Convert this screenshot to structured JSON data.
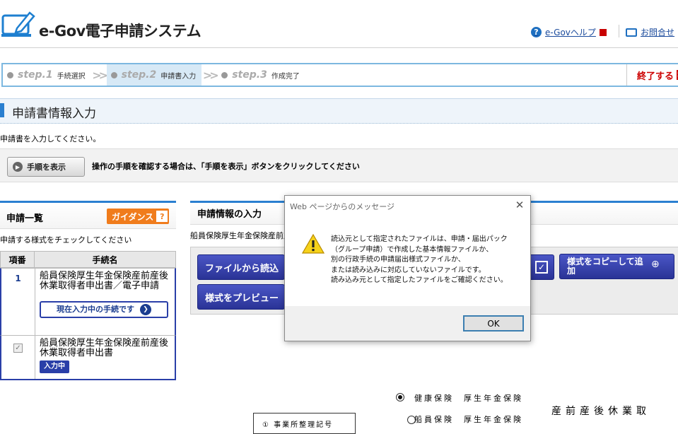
{
  "header": {
    "logo_text": "e-Gov電子申請システム",
    "help_link": "e-Govヘルプ",
    "contact_link": "お問合せ"
  },
  "steps": [
    {
      "num": "step.1",
      "label": "手続選択"
    },
    {
      "num": "step.2",
      "label": "申請書入力"
    },
    {
      "num": "step.3",
      "label": "作成完了"
    }
  ],
  "finish_label": "終了する",
  "page_title": "申請書情報入力",
  "instruction": "申請書を入力してください。",
  "procedure": {
    "button_label": "手順を表示",
    "text": "操作の手順を確認する場合は、「手順を表示」ボタンをクリックしてください"
  },
  "left_panel": {
    "title": "申請一覧",
    "guidance_label": "ガイダンス",
    "instruction": "申請する様式をチェックしてください",
    "col_no": "項番",
    "col_name": "手続名",
    "rows": [
      {
        "no": "1",
        "name": "船員保険厚生年金保険産前産後休業取得者申出書／電子申請",
        "button": "現在入力中の手続です"
      },
      {
        "name": "船員保険厚生年金保険産前産後休業取得者申出書",
        "badge": "入力中"
      }
    ]
  },
  "right_panel": {
    "title": "申請情報の入力",
    "subtitle": "船員保険厚生年金保険産前産後休業取得者申出書",
    "buttons": {
      "file_load": "ファイルから読込",
      "preview": "様式をプレビュー",
      "copy_add": "様式をコピーして追加"
    }
  },
  "bottom": {
    "radio1": "健康保険　厚生年金保険",
    "radio2": "船員保険　厚生年金保険",
    "boxed": "① 事業所整理記号",
    "big": "産前産後休業取"
  },
  "dialog": {
    "title": "Web ページからのメッセージ",
    "message": "読込元として指定されたファイルは、申請・届出パック\n（グループ申請）で作成した基本情報ファイルか、\n別の行政手続の申請届出様式ファイルか、\nまたは読み込みに対応していないファイルです。\n読み込み元として指定したファイルをご確認ください。",
    "ok_label": "OK"
  },
  "colors": {
    "accent_blue": "#2a7fd0",
    "button_navy": "#2a3396",
    "guidance_orange": "#f07c1c",
    "finish_red": "#cc0000"
  }
}
